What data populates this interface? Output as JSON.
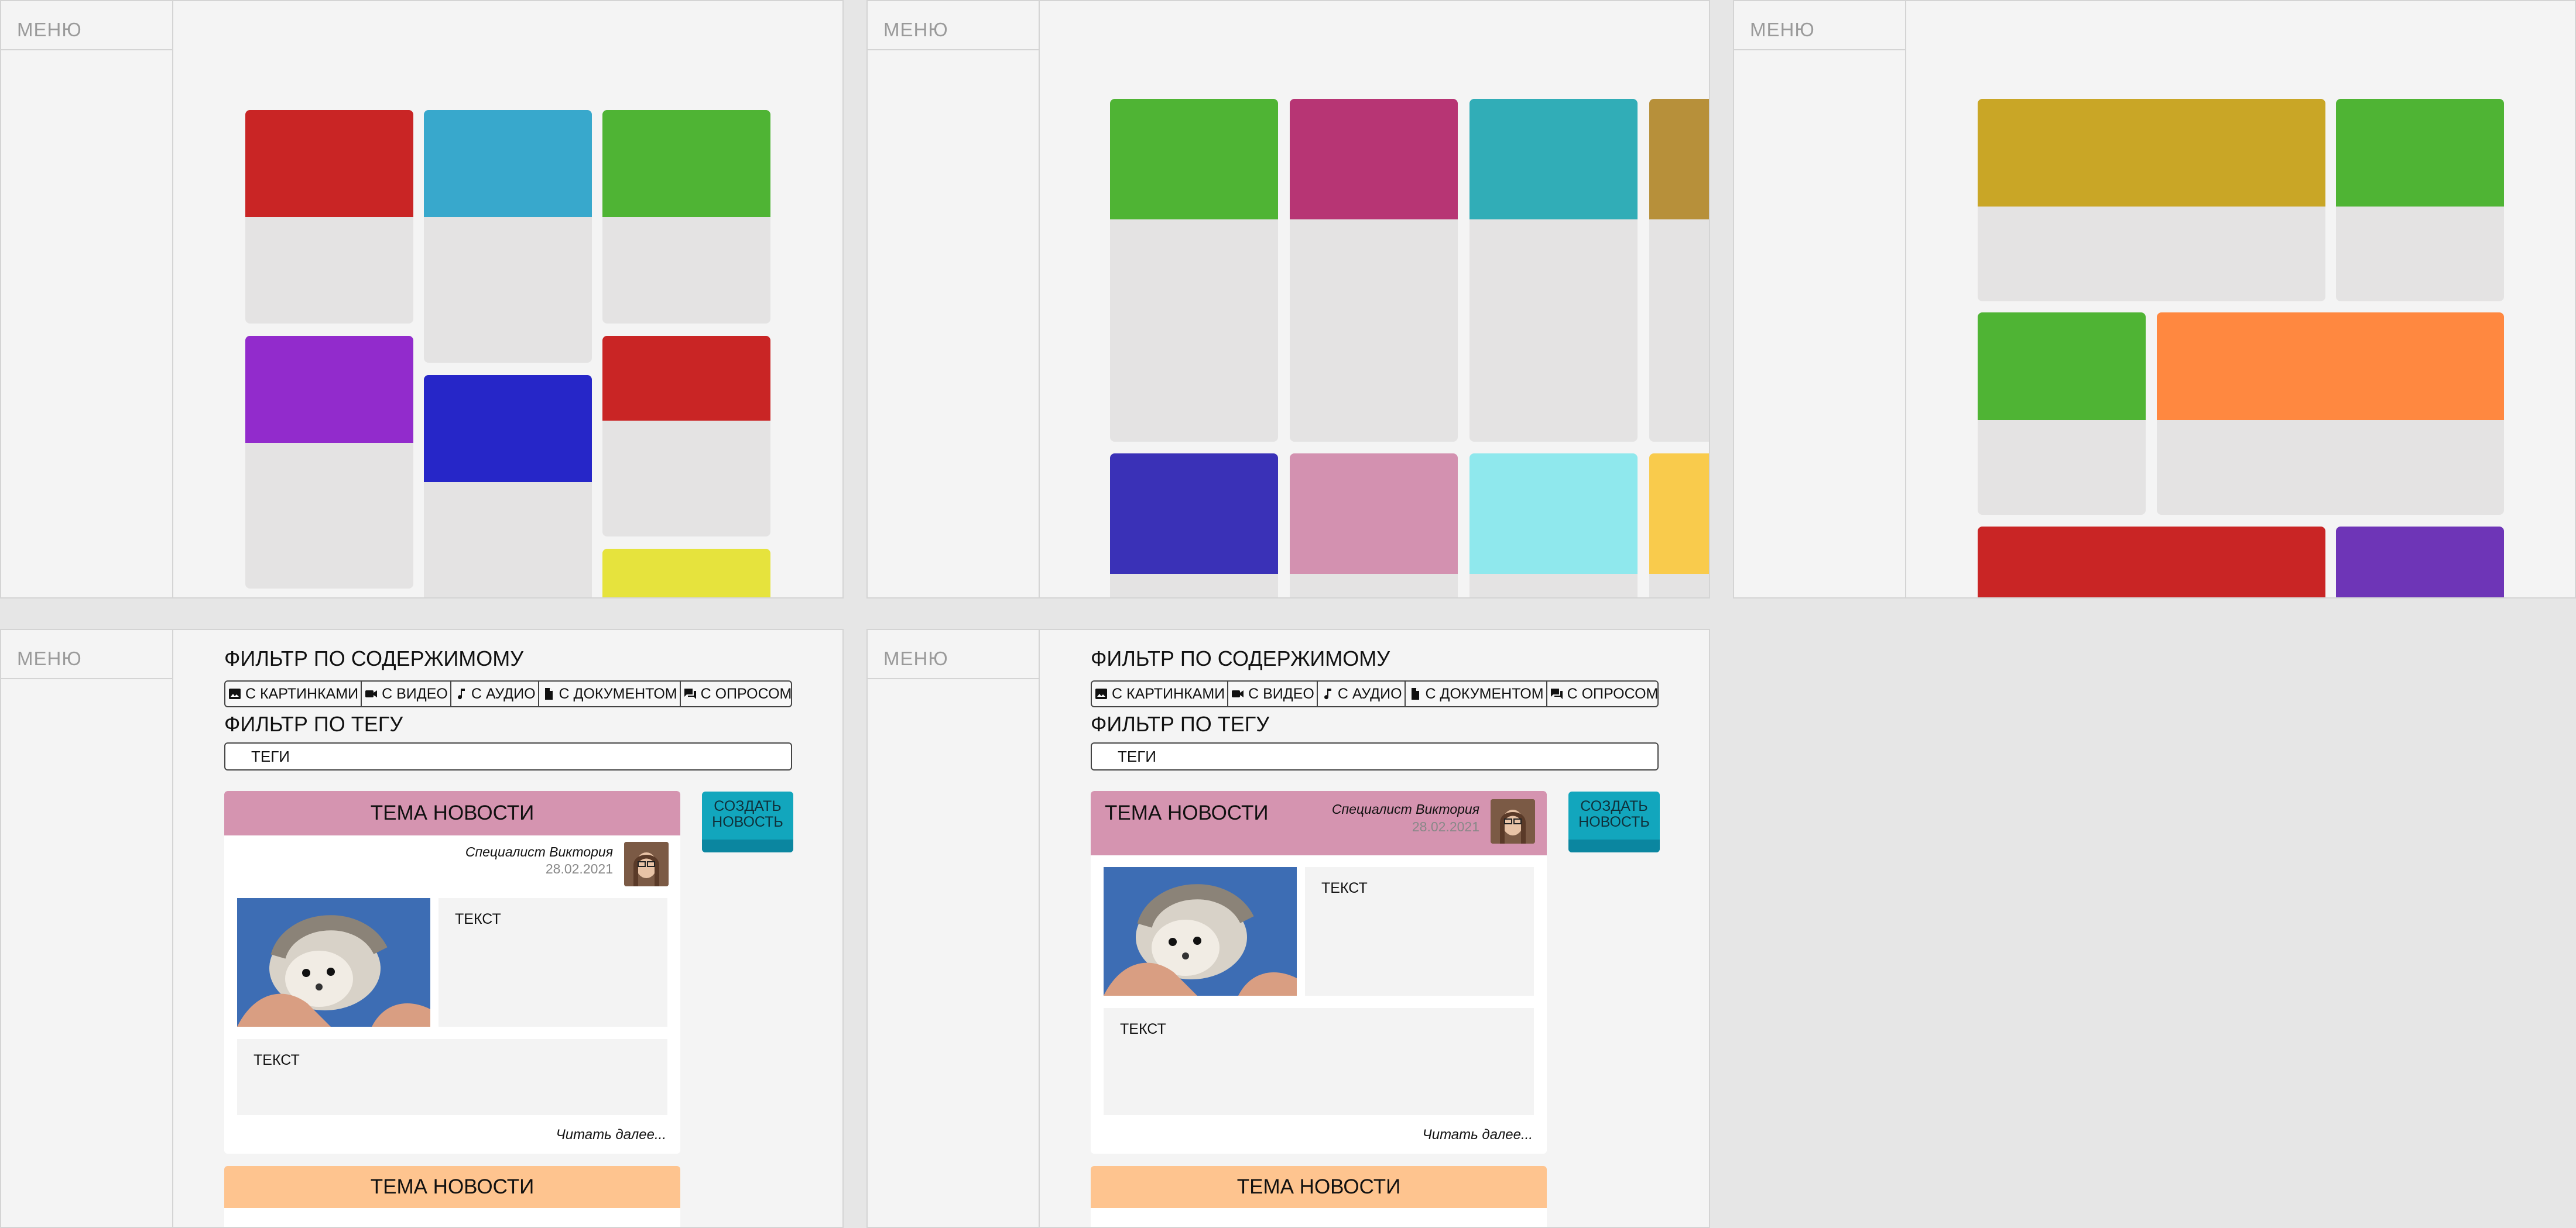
{
  "menu_label": "МЕНЮ",
  "frames": {
    "masonry_cards": [
      "#c92525",
      "#38a8cc",
      "#4fb434",
      "#922bcc",
      "#2626c8",
      "#c92525",
      "#e6e33d"
    ],
    "grid_cards": [
      "#4fb434",
      "#b73574",
      "#31adb7",
      "#b7903a",
      "#3a31b7",
      "#d391b0",
      "#8fe8ed",
      "#f9cb4c"
    ],
    "mixed_cards": [
      "#c9a626",
      "#4fb434",
      "#4fb434",
      "#ff8840",
      "#c92525",
      "#6e35b7"
    ]
  },
  "feed": {
    "filter_content_title": "ФИЛЬТР ПО СОДЕРЖИМОМУ",
    "filters": [
      {
        "label": "С КАРТИНКАМИ",
        "icon": "image-icon"
      },
      {
        "label": "С ВИДЕО",
        "icon": "video-icon"
      },
      {
        "label": "С АУДИО",
        "icon": "music-note-icon"
      },
      {
        "label": "С ДОКУМЕНТОМ",
        "icon": "document-icon"
      },
      {
        "label": "С ОПРОСОМ",
        "icon": "poll-chat-icon"
      }
    ],
    "filter_tag_title": "ФИЛЬТР ПО ТЕГУ",
    "tag_placeholder": "ТЕГИ",
    "create_button": "СОЗДАТЬ\nНОВОСТЬ",
    "news": {
      "title": "ТЕМА НОВОСТИ",
      "author": "Специалист Виктория",
      "date": "28.02.2021",
      "text_1": "ТЕКСТ",
      "text_2": "ТЕКСТ",
      "read_more": "Читать далее..."
    },
    "news_2_title": "ТЕМА НОВОСТИ",
    "colors": {
      "news_header": "#d594b0",
      "news_header_2": "#fec48f",
      "create_button": "#12a6bd"
    }
  }
}
